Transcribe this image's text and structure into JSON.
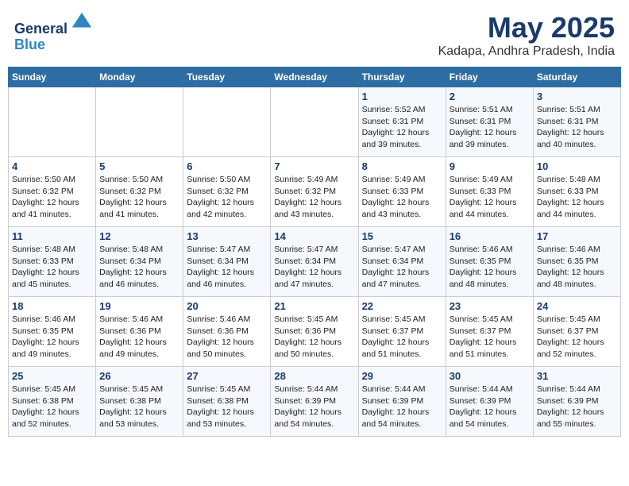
{
  "header": {
    "logo_line1": "General",
    "logo_line2": "Blue",
    "month": "May 2025",
    "location": "Kadapa, Andhra Pradesh, India"
  },
  "weekdays": [
    "Sunday",
    "Monday",
    "Tuesday",
    "Wednesday",
    "Thursday",
    "Friday",
    "Saturday"
  ],
  "weeks": [
    [
      {
        "day": "",
        "info": ""
      },
      {
        "day": "",
        "info": ""
      },
      {
        "day": "",
        "info": ""
      },
      {
        "day": "",
        "info": ""
      },
      {
        "day": "1",
        "info": "Sunrise: 5:52 AM\nSunset: 6:31 PM\nDaylight: 12 hours and 39 minutes."
      },
      {
        "day": "2",
        "info": "Sunrise: 5:51 AM\nSunset: 6:31 PM\nDaylight: 12 hours and 39 minutes."
      },
      {
        "day": "3",
        "info": "Sunrise: 5:51 AM\nSunset: 6:31 PM\nDaylight: 12 hours and 40 minutes."
      }
    ],
    [
      {
        "day": "4",
        "info": "Sunrise: 5:50 AM\nSunset: 6:32 PM\nDaylight: 12 hours and 41 minutes."
      },
      {
        "day": "5",
        "info": "Sunrise: 5:50 AM\nSunset: 6:32 PM\nDaylight: 12 hours and 41 minutes."
      },
      {
        "day": "6",
        "info": "Sunrise: 5:50 AM\nSunset: 6:32 PM\nDaylight: 12 hours and 42 minutes."
      },
      {
        "day": "7",
        "info": "Sunrise: 5:49 AM\nSunset: 6:32 PM\nDaylight: 12 hours and 43 minutes."
      },
      {
        "day": "8",
        "info": "Sunrise: 5:49 AM\nSunset: 6:33 PM\nDaylight: 12 hours and 43 minutes."
      },
      {
        "day": "9",
        "info": "Sunrise: 5:49 AM\nSunset: 6:33 PM\nDaylight: 12 hours and 44 minutes."
      },
      {
        "day": "10",
        "info": "Sunrise: 5:48 AM\nSunset: 6:33 PM\nDaylight: 12 hours and 44 minutes."
      }
    ],
    [
      {
        "day": "11",
        "info": "Sunrise: 5:48 AM\nSunset: 6:33 PM\nDaylight: 12 hours and 45 minutes."
      },
      {
        "day": "12",
        "info": "Sunrise: 5:48 AM\nSunset: 6:34 PM\nDaylight: 12 hours and 46 minutes."
      },
      {
        "day": "13",
        "info": "Sunrise: 5:47 AM\nSunset: 6:34 PM\nDaylight: 12 hours and 46 minutes."
      },
      {
        "day": "14",
        "info": "Sunrise: 5:47 AM\nSunset: 6:34 PM\nDaylight: 12 hours and 47 minutes."
      },
      {
        "day": "15",
        "info": "Sunrise: 5:47 AM\nSunset: 6:34 PM\nDaylight: 12 hours and 47 minutes."
      },
      {
        "day": "16",
        "info": "Sunrise: 5:46 AM\nSunset: 6:35 PM\nDaylight: 12 hours and 48 minutes."
      },
      {
        "day": "17",
        "info": "Sunrise: 5:46 AM\nSunset: 6:35 PM\nDaylight: 12 hours and 48 minutes."
      }
    ],
    [
      {
        "day": "18",
        "info": "Sunrise: 5:46 AM\nSunset: 6:35 PM\nDaylight: 12 hours and 49 minutes."
      },
      {
        "day": "19",
        "info": "Sunrise: 5:46 AM\nSunset: 6:36 PM\nDaylight: 12 hours and 49 minutes."
      },
      {
        "day": "20",
        "info": "Sunrise: 5:46 AM\nSunset: 6:36 PM\nDaylight: 12 hours and 50 minutes."
      },
      {
        "day": "21",
        "info": "Sunrise: 5:45 AM\nSunset: 6:36 PM\nDaylight: 12 hours and 50 minutes."
      },
      {
        "day": "22",
        "info": "Sunrise: 5:45 AM\nSunset: 6:37 PM\nDaylight: 12 hours and 51 minutes."
      },
      {
        "day": "23",
        "info": "Sunrise: 5:45 AM\nSunset: 6:37 PM\nDaylight: 12 hours and 51 minutes."
      },
      {
        "day": "24",
        "info": "Sunrise: 5:45 AM\nSunset: 6:37 PM\nDaylight: 12 hours and 52 minutes."
      }
    ],
    [
      {
        "day": "25",
        "info": "Sunrise: 5:45 AM\nSunset: 6:38 PM\nDaylight: 12 hours and 52 minutes."
      },
      {
        "day": "26",
        "info": "Sunrise: 5:45 AM\nSunset: 6:38 PM\nDaylight: 12 hours and 53 minutes."
      },
      {
        "day": "27",
        "info": "Sunrise: 5:45 AM\nSunset: 6:38 PM\nDaylight: 12 hours and 53 minutes."
      },
      {
        "day": "28",
        "info": "Sunrise: 5:44 AM\nSunset: 6:39 PM\nDaylight: 12 hours and 54 minutes."
      },
      {
        "day": "29",
        "info": "Sunrise: 5:44 AM\nSunset: 6:39 PM\nDaylight: 12 hours and 54 minutes."
      },
      {
        "day": "30",
        "info": "Sunrise: 5:44 AM\nSunset: 6:39 PM\nDaylight: 12 hours and 54 minutes."
      },
      {
        "day": "31",
        "info": "Sunrise: 5:44 AM\nSunset: 6:39 PM\nDaylight: 12 hours and 55 minutes."
      }
    ]
  ]
}
